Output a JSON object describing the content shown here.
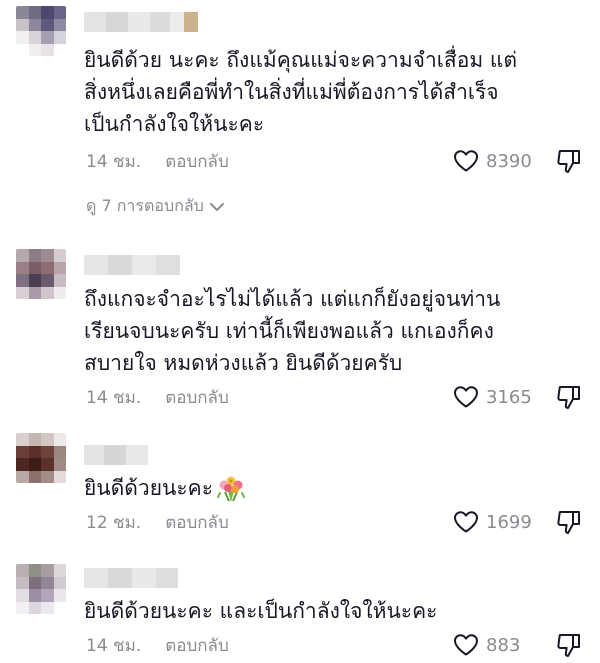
{
  "comments": [
    {
      "text": "ยินดีด้วย นะคะ ถึงแม้คุณแม่จะความจำเสื่อม แต่\nสิ่งหนึ่งเลยคือพี่ทำในสิ่งที่แม่พี่ต้องการได้สำเร็จ\nเป็นกำลังใจให้นะคะ",
      "time": "14 ชม.",
      "reply_label": "ตอบกลับ",
      "likes": "8390",
      "view_replies": "ดู 7 การตอบกลับ"
    },
    {
      "text": "ถึงแกจะจำอะไรไม่ได้แล้ว แต่แกก็ยังอยู่จนท่าน\nเรียนจบนะครับ เท่านี้ก็เพียงพอแล้ว แกเองก็คง\nสบายใจ หมดห่วงแล้ว ยินดีด้วยครับ",
      "time": "14 ชม.",
      "reply_label": "ตอบกลับ",
      "likes": "3165"
    },
    {
      "text": "ยินดีด้วยนะคะ",
      "emoji": "bouquet-emoji",
      "time": "12 ชม.",
      "reply_label": "ตอบกลับ",
      "likes": "1699"
    },
    {
      "text": "ยินดีด้วยนะคะ และเป็นกำลังใจให้นะคะ",
      "time": "14 ชม.",
      "reply_label": "ตอบกลับ",
      "likes": "883"
    }
  ],
  "icons": {
    "like": "heart-outline-icon",
    "dislike": "thumbs-down-outline-icon",
    "expand": "chevron-down-icon"
  },
  "colors": {
    "text": "#161823",
    "muted": "#8a8b91"
  }
}
